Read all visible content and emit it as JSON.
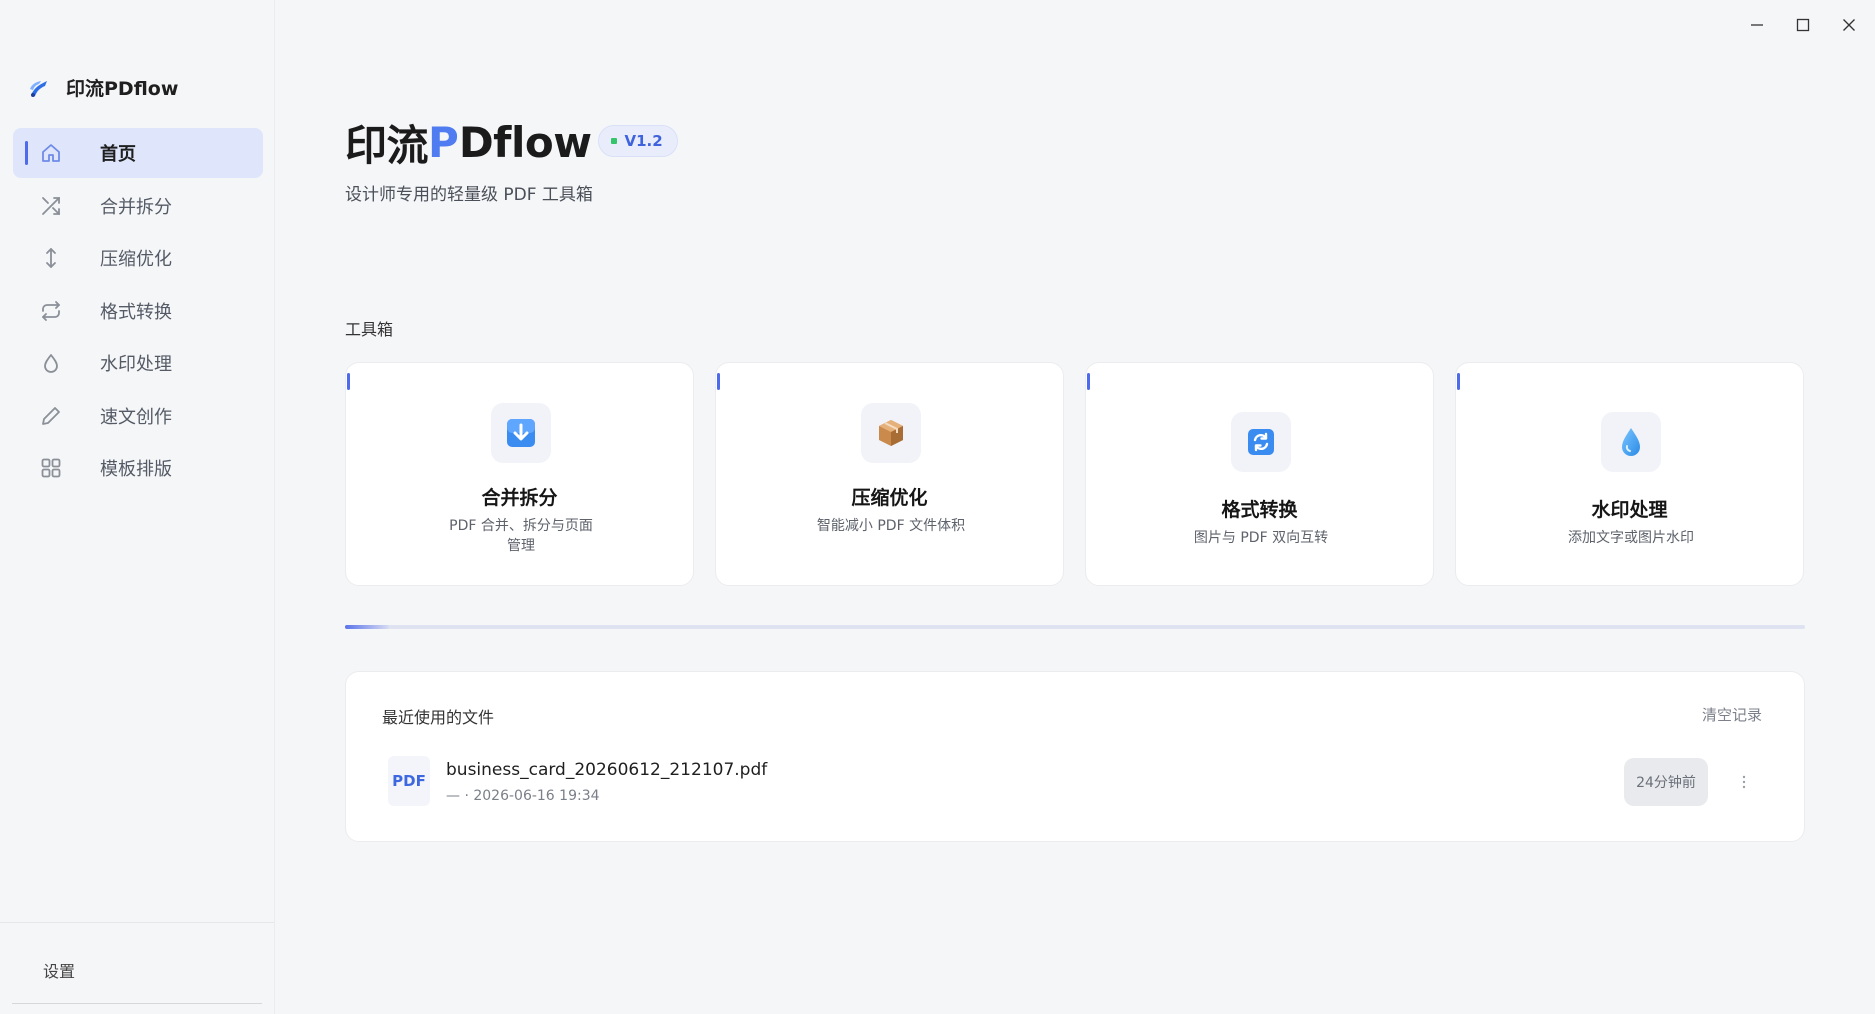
{
  "window": {
    "controls": {
      "minimize": "minimize-icon",
      "maximize": "maximize-icon",
      "close": "close-icon"
    }
  },
  "sidebar": {
    "brand": "印流PDflow",
    "items": [
      {
        "label": "首页",
        "icon": "home-icon",
        "active": true
      },
      {
        "label": "合并拆分",
        "icon": "shuffle-icon",
        "active": false
      },
      {
        "label": "压缩优化",
        "icon": "vertical-arrows-icon",
        "active": false
      },
      {
        "label": "格式转换",
        "icon": "repeat-icon",
        "active": false
      },
      {
        "label": "水印处理",
        "icon": "droplet-icon",
        "active": false
      },
      {
        "label": "速文创作",
        "icon": "pencil-icon",
        "active": false
      },
      {
        "label": "模板排版",
        "icon": "grid-icon",
        "active": false
      }
    ],
    "settings_label": "设置"
  },
  "header": {
    "title_part1": "印流",
    "title_part2": "P",
    "title_part3": "Dflow",
    "version": "V1.2",
    "subtitle": "设计师专用的轻量级 PDF 工具箱"
  },
  "toolbox": {
    "label": "工具箱",
    "cards": [
      {
        "title": "合并拆分",
        "desc": "PDF 合并、拆分与页面管理",
        "icon": "download-box-icon"
      },
      {
        "title": "压缩优化",
        "desc": "智能减小 PDF 文件体积",
        "icon": "package-icon"
      },
      {
        "title": "格式转换",
        "desc": "图片与 PDF 双向互转",
        "icon": "convert-icon"
      },
      {
        "title": "水印处理",
        "desc": "添加文字或图片水印",
        "icon": "water-drop-icon"
      }
    ]
  },
  "progress": {
    "value": 0.03
  },
  "recent": {
    "title": "最近使用的文件",
    "clear_label": "清空记录",
    "files": [
      {
        "badge": "PDF",
        "name": "business_card_20260612_212107.pdf",
        "meta": "— · 2026-06-16 19:34",
        "time": "24分钟前"
      }
    ]
  },
  "colors": {
    "accent": "#4d6bea",
    "brand_blue": "#4f7cf0",
    "active_bg": "#dfe6fc",
    "version_dot": "#35c46b"
  }
}
